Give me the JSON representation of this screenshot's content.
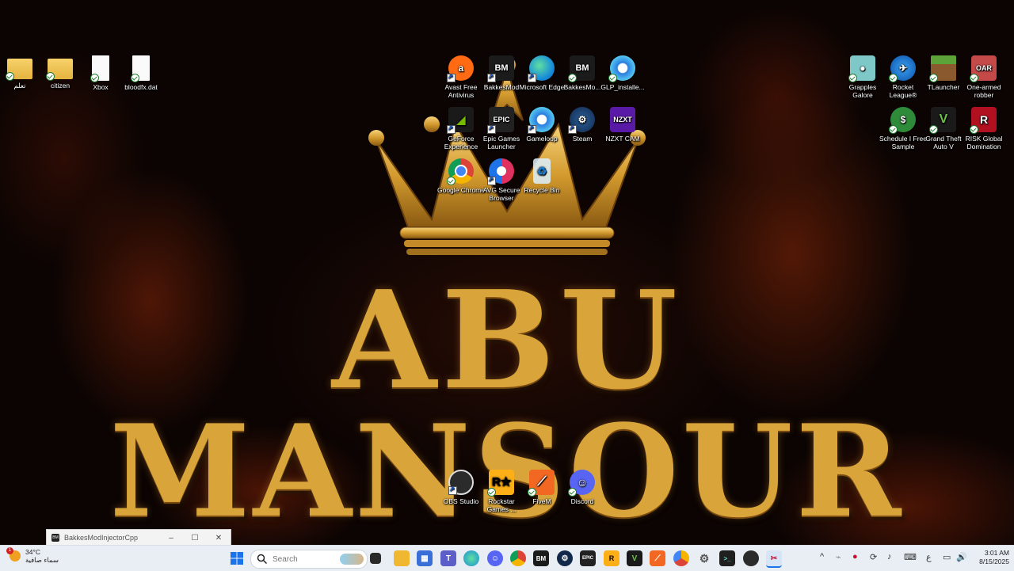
{
  "wallpaper": {
    "line1": "ABU",
    "line2": "MANSOUR"
  },
  "desktop_icons_left": [
    {
      "label": "تعلم",
      "icon": "folder-icon"
    },
    {
      "label": "citizen",
      "icon": "folder-icon"
    },
    {
      "label": "Xbox",
      "icon": "file-icon"
    },
    {
      "label": "bloodfx.dat",
      "icon": "file-icon"
    }
  ],
  "desktop_icons_center": [
    {
      "label": "Avast Free Antivirus",
      "icon": "avast-icon"
    },
    {
      "label": "BakkesMod",
      "icon": "bakkesmod-icon"
    },
    {
      "label": "Microsoft Edge",
      "icon": "edge-icon"
    },
    {
      "label": "BakkesMo...",
      "icon": "bakkesmod-icon"
    },
    {
      "label": "GLP_installe...",
      "icon": "gameloop-icon"
    },
    {
      "label": "GeForce Experience",
      "icon": "geforce-icon"
    },
    {
      "label": "Epic Games Launcher",
      "icon": "epic-games-icon"
    },
    {
      "label": "Gameloop",
      "icon": "gameloop-icon"
    },
    {
      "label": "Steam",
      "icon": "steam-icon"
    },
    {
      "label": "NZXT CAM",
      "icon": "nzxt-icon"
    },
    {
      "label": "Google Chrome",
      "icon": "chrome-icon"
    },
    {
      "label": "AVG Secure Browser",
      "icon": "avg-browser-icon"
    },
    {
      "label": "Recycle Bin",
      "icon": "recycle-bin-icon"
    }
  ],
  "desktop_icons_right": [
    {
      "label": "Grapples Galore",
      "icon": "game-icon"
    },
    {
      "label": "Rocket League®",
      "icon": "rocket-league-icon"
    },
    {
      "label": "TLauncher",
      "icon": "minecraft-icon"
    },
    {
      "label": "One-armed robber",
      "icon": "game-icon"
    },
    {
      "label": "Schedule I Free Sample",
      "icon": "game-icon"
    },
    {
      "label": "Grand Theft Auto V",
      "icon": "gta-icon"
    },
    {
      "label": "RISK Global Domination",
      "icon": "risk-icon"
    }
  ],
  "desktop_icons_bottom": [
    {
      "label": "OBS Studio",
      "icon": "obs-icon"
    },
    {
      "label": "Rockstar Games ...",
      "icon": "rockstar-icon"
    },
    {
      "label": "FiveM",
      "icon": "fivem-icon"
    },
    {
      "label": "Discord",
      "icon": "discord-icon"
    }
  ],
  "window": {
    "title": "BakkesModInjectorCpp",
    "minimize": "–",
    "maximize": "☐",
    "close": "✕"
  },
  "taskbar": {
    "weather_temp": "34°C",
    "weather_desc": "سماء صافية",
    "weather_badge": "1",
    "search_placeholder": "Search",
    "ime": "ع",
    "time": "3:01 AM",
    "date": "8/15/2025",
    "pinned": [
      "start-icon",
      "task-view-icon",
      "file-explorer-icon",
      "store-icon",
      "teams-icon",
      "edge-icon",
      "discord-icon",
      "chrome-icon",
      "bakkesmod-icon",
      "steam-icon",
      "epic-games-icon",
      "rockstar-icon",
      "gta-icon",
      "fivem-icon",
      "chrome-canary-icon",
      "settings-icon",
      "terminal-icon",
      "obs-icon",
      "snipping-tool-icon"
    ],
    "tray": [
      "chevron-up-icon",
      "usb-icon",
      "avast-tray-icon",
      "sync-icon",
      "microphone-icon",
      "keyboard-icon",
      "network-icon",
      "volume-icon"
    ]
  }
}
